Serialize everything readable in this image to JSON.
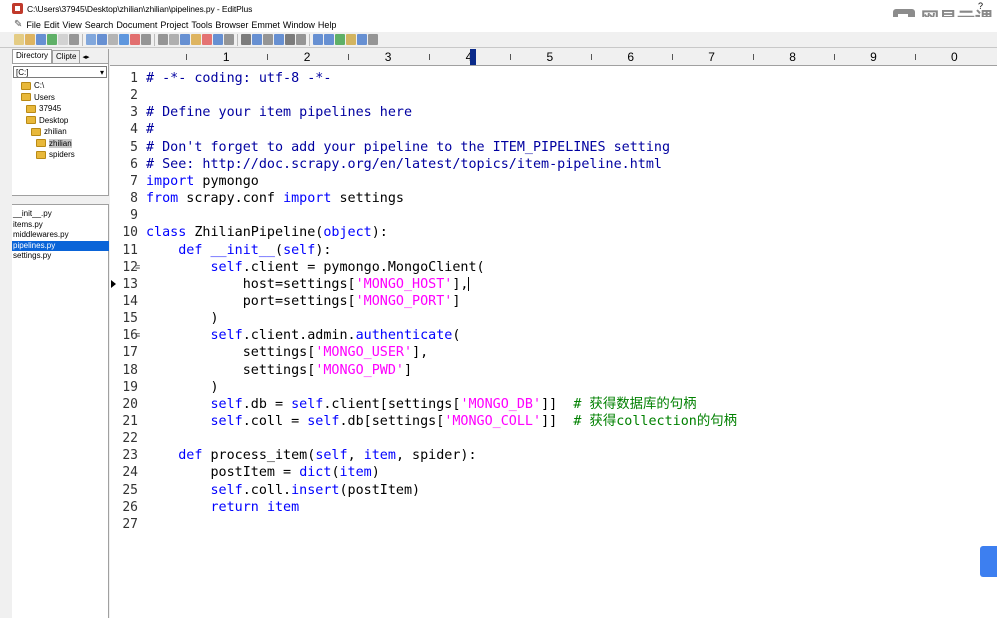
{
  "window": {
    "title": "C:\\Users\\37945\\Desktop\\zhilian\\zhilian\\pipelines.py - EditPlus",
    "top_right_marker": "?"
  },
  "brand": {
    "text": "网易云课"
  },
  "menu": [
    "File",
    "Edit",
    "View",
    "Search",
    "Document",
    "Project",
    "Tools",
    "Browser",
    "Emmet",
    "Window",
    "Help"
  ],
  "left_panel": {
    "tabs": [
      "Directory",
      "Clipte"
    ],
    "tab_arrows": "◂▸",
    "drive": "[C:]",
    "drive_arrow": "▾",
    "tree": [
      {
        "label": "C:\\",
        "depth": 1
      },
      {
        "label": "Users",
        "depth": 1
      },
      {
        "label": "37945",
        "depth": 2
      },
      {
        "label": "Desktop",
        "depth": 2
      },
      {
        "label": "zhilian",
        "depth": 3
      },
      {
        "label": "zhilian",
        "depth": 4,
        "selected": true
      },
      {
        "label": "spiders",
        "depth": 4
      }
    ],
    "files": [
      {
        "label": "__init__.py"
      },
      {
        "label": "items.py"
      },
      {
        "label": "middlewares.py"
      },
      {
        "label": "pipelines.py",
        "selected": true
      },
      {
        "label": "settings.py"
      }
    ]
  },
  "ruler": {
    "numbers": [
      "1",
      "2",
      "3",
      "4",
      "5",
      "6",
      "7",
      "8",
      "9",
      "0"
    ]
  },
  "editor": {
    "current_line": 13,
    "lines": [
      {
        "n": "1",
        "parts": [
          [
            "cm",
            "# -*- coding: utf-8 -*-"
          ]
        ]
      },
      {
        "n": "2",
        "parts": []
      },
      {
        "n": "3",
        "parts": [
          [
            "cm",
            "# Define your item pipelines here"
          ]
        ]
      },
      {
        "n": "4",
        "parts": [
          [
            "cm",
            "#"
          ]
        ]
      },
      {
        "n": "5",
        "parts": [
          [
            "cm",
            "# Don't forget to add your pipeline to the ITEM_PIPELINES setting"
          ]
        ]
      },
      {
        "n": "6",
        "parts": [
          [
            "cm",
            "# See: http://doc.scrapy.org/en/latest/topics/item-pipeline.html"
          ]
        ]
      },
      {
        "n": "7",
        "parts": [
          [
            "kw",
            "import"
          ],
          [
            "",
            " pymongo"
          ]
        ]
      },
      {
        "n": "8",
        "parts": [
          [
            "kw",
            "from"
          ],
          [
            "",
            " scrapy.conf "
          ],
          [
            "kw",
            "import"
          ],
          [
            "",
            " settings"
          ]
        ]
      },
      {
        "n": "9",
        "parts": []
      },
      {
        "n": "10",
        "parts": [
          [
            "kw",
            "class"
          ],
          [
            "",
            " ZhilianPipeline("
          ],
          [
            "kw",
            "object"
          ],
          [
            "",
            "):"
          ]
        ]
      },
      {
        "n": "11",
        "parts": [
          [
            "",
            "    "
          ],
          [
            "kw",
            "def"
          ],
          [
            "",
            " "
          ],
          [
            "kw",
            "__init__"
          ],
          [
            "",
            "("
          ],
          [
            "kw",
            "self"
          ],
          [
            "",
            "):"
          ]
        ]
      },
      {
        "n": "12",
        "fold": true,
        "parts": [
          [
            "",
            "        "
          ],
          [
            "kw",
            "self"
          ],
          [
            "",
            ".client = pymongo.MongoClient("
          ]
        ]
      },
      {
        "n": "13",
        "caret": true,
        "parts": [
          [
            "",
            "            host=settings["
          ],
          [
            "str",
            "'MONGO_HOST'"
          ],
          [
            "",
            "],"
          ]
        ]
      },
      {
        "n": "14",
        "parts": [
          [
            "",
            "            port=settings["
          ],
          [
            "str",
            "'MONGO_PORT'"
          ],
          [
            "",
            "]"
          ]
        ]
      },
      {
        "n": "15",
        "parts": [
          [
            "",
            "        )"
          ]
        ]
      },
      {
        "n": "16",
        "fold": true,
        "parts": [
          [
            "",
            "        "
          ],
          [
            "kw",
            "self"
          ],
          [
            "",
            ".client.admin."
          ],
          [
            "kw",
            "authenticate"
          ],
          [
            "",
            "("
          ]
        ]
      },
      {
        "n": "17",
        "parts": [
          [
            "",
            "            settings["
          ],
          [
            "str",
            "'MONGO_USER'"
          ],
          [
            "",
            "],"
          ]
        ]
      },
      {
        "n": "18",
        "parts": [
          [
            "",
            "            settings["
          ],
          [
            "str",
            "'MONGO_PWD'"
          ],
          [
            "",
            "]"
          ]
        ]
      },
      {
        "n": "19",
        "parts": [
          [
            "",
            "        )"
          ]
        ]
      },
      {
        "n": "20",
        "parts": [
          [
            "",
            "        "
          ],
          [
            "kw",
            "self"
          ],
          [
            "",
            ".db = "
          ],
          [
            "kw",
            "self"
          ],
          [
            "",
            ".client[settings["
          ],
          [
            "str",
            "'MONGO_DB'"
          ],
          [
            "",
            "]]  "
          ],
          [
            "zh-cm",
            "# 获得数据库的句柄"
          ]
        ]
      },
      {
        "n": "21",
        "parts": [
          [
            "",
            "        "
          ],
          [
            "kw",
            "self"
          ],
          [
            "",
            ".coll = "
          ],
          [
            "kw",
            "self"
          ],
          [
            "",
            ".db[settings["
          ],
          [
            "str",
            "'MONGO_COLL'"
          ],
          [
            "",
            "]]  "
          ],
          [
            "zh-cm",
            "# 获得collection的句柄"
          ]
        ]
      },
      {
        "n": "22",
        "parts": []
      },
      {
        "n": "23",
        "parts": [
          [
            "",
            "    "
          ],
          [
            "kw",
            "def"
          ],
          [
            "",
            " process_item("
          ],
          [
            "kw",
            "self"
          ],
          [
            "",
            ", "
          ],
          [
            "kw",
            "item"
          ],
          [
            "",
            ", spider):"
          ]
        ]
      },
      {
        "n": "24",
        "parts": [
          [
            "",
            "        postItem = "
          ],
          [
            "kw",
            "dict"
          ],
          [
            "",
            "("
          ],
          [
            "kw",
            "item"
          ],
          [
            "",
            ")"
          ]
        ]
      },
      {
        "n": "25",
        "parts": [
          [
            "",
            "        "
          ],
          [
            "kw",
            "self"
          ],
          [
            "",
            ".coll."
          ],
          [
            "kw",
            "insert"
          ],
          [
            "",
            "(postItem)"
          ]
        ]
      },
      {
        "n": "26",
        "parts": [
          [
            "",
            "        "
          ],
          [
            "kw",
            "return"
          ],
          [
            "",
            " "
          ],
          [
            "kw",
            "item"
          ]
        ]
      },
      {
        "n": "27",
        "parts": []
      }
    ]
  },
  "colors": {
    "comment": "#0000a0",
    "keyword": "#0000ff",
    "string": "#ff00ff",
    "chinese_comment": "#008000",
    "selection": "#0a64d8"
  }
}
